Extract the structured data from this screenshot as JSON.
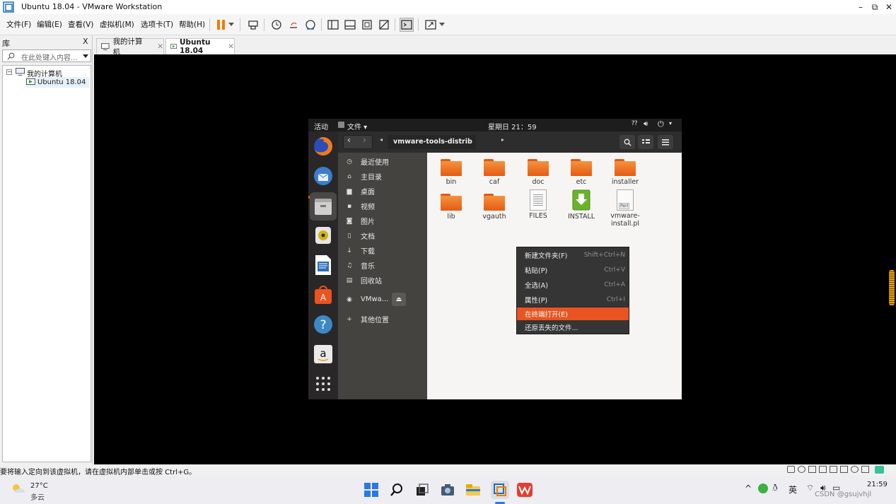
{
  "window": {
    "title": "Ubuntu 18.04 - VMware Workstation",
    "controls": {
      "minimize": "–",
      "maximize": "⧉",
      "close": "✕"
    }
  },
  "menubar": {
    "items": [
      "文件(F)",
      "编辑(E)",
      "查看(V)",
      "虚拟机(M)",
      "选项卡(T)",
      "帮助(H)"
    ]
  },
  "library": {
    "header": "库",
    "close": "X",
    "search_placeholder": "在此处键入内容...",
    "tree": {
      "root": "我的计算机",
      "child": "Ubuntu 18.04"
    }
  },
  "tabs": [
    {
      "label": "我的计算机",
      "active": false
    },
    {
      "label": "Ubuntu 18.04",
      "active": true
    }
  ],
  "ubuntu": {
    "topbar": {
      "activities": "活动",
      "app_menu": "文件 ▾",
      "clock": "星期日 21：59"
    },
    "nautilus": {
      "path": "vmware-tools-distrib"
    },
    "sidebar": [
      {
        "icon": "clock-icon",
        "glyph": "◷",
        "label": "最近使用"
      },
      {
        "icon": "home-icon",
        "glyph": "⌂",
        "label": "主目录"
      },
      {
        "icon": "folder-icon",
        "glyph": "▆",
        "label": "桌面"
      },
      {
        "icon": "video-icon",
        "glyph": "▪",
        "label": "视频"
      },
      {
        "icon": "camera-icon",
        "glyph": "◙",
        "label": "图片"
      },
      {
        "icon": "document-icon",
        "glyph": "▯",
        "label": "文档"
      },
      {
        "icon": "download-icon",
        "glyph": "↓",
        "label": "下载"
      },
      {
        "icon": "music-icon",
        "glyph": "♫",
        "label": "音乐"
      },
      {
        "icon": "trash-icon",
        "glyph": "▤",
        "label": "回收站"
      },
      {
        "icon": "disc-icon",
        "glyph": "◉",
        "label": "VMwa..."
      },
      {
        "icon": "plus-icon",
        "glyph": "+",
        "label": "其他位置"
      }
    ],
    "files": [
      {
        "name": "bin",
        "kind": "folder"
      },
      {
        "name": "caf",
        "kind": "folder"
      },
      {
        "name": "doc",
        "kind": "folder"
      },
      {
        "name": "etc",
        "kind": "folder"
      },
      {
        "name": "installer",
        "kind": "folder"
      },
      {
        "name": "lib",
        "kind": "folder"
      },
      {
        "name": "vgauth",
        "kind": "folder"
      },
      {
        "name": "FILES",
        "kind": "text"
      },
      {
        "name": "INSTALL",
        "kind": "install"
      },
      {
        "name": "vmware-install.pl",
        "kind": "perl"
      }
    ],
    "perl_badge": "Perl",
    "context_menu": [
      {
        "label": "新建文件夹(F)",
        "shortcut": "Shift+Ctrl+N"
      },
      {
        "label": "粘贴(P)",
        "shortcut": "Ctrl+V"
      },
      {
        "label": "全选(A)",
        "shortcut": "Ctrl+A"
      },
      {
        "label": "属性(P)",
        "shortcut": "Ctrl+I"
      },
      {
        "label": "在终端打开(E)",
        "shortcut": "",
        "highlighted": true
      },
      {
        "label": "还原丢失的文件...",
        "shortcut": ""
      }
    ]
  },
  "statusbar": {
    "text": "要将输入定向到该虚拟机，请在虚拟机内部单击或按 Ctrl+G。"
  },
  "taskbar": {
    "weather_temp": "27°C",
    "weather_desc": "多云",
    "ime": "英",
    "time": "21:59",
    "watermark": "CSDN @gsujvhjl"
  },
  "colors": {
    "ubuntu_orange": "#e95420",
    "vm_background": "#000000",
    "ubuntu_sidebar": "#444340"
  }
}
